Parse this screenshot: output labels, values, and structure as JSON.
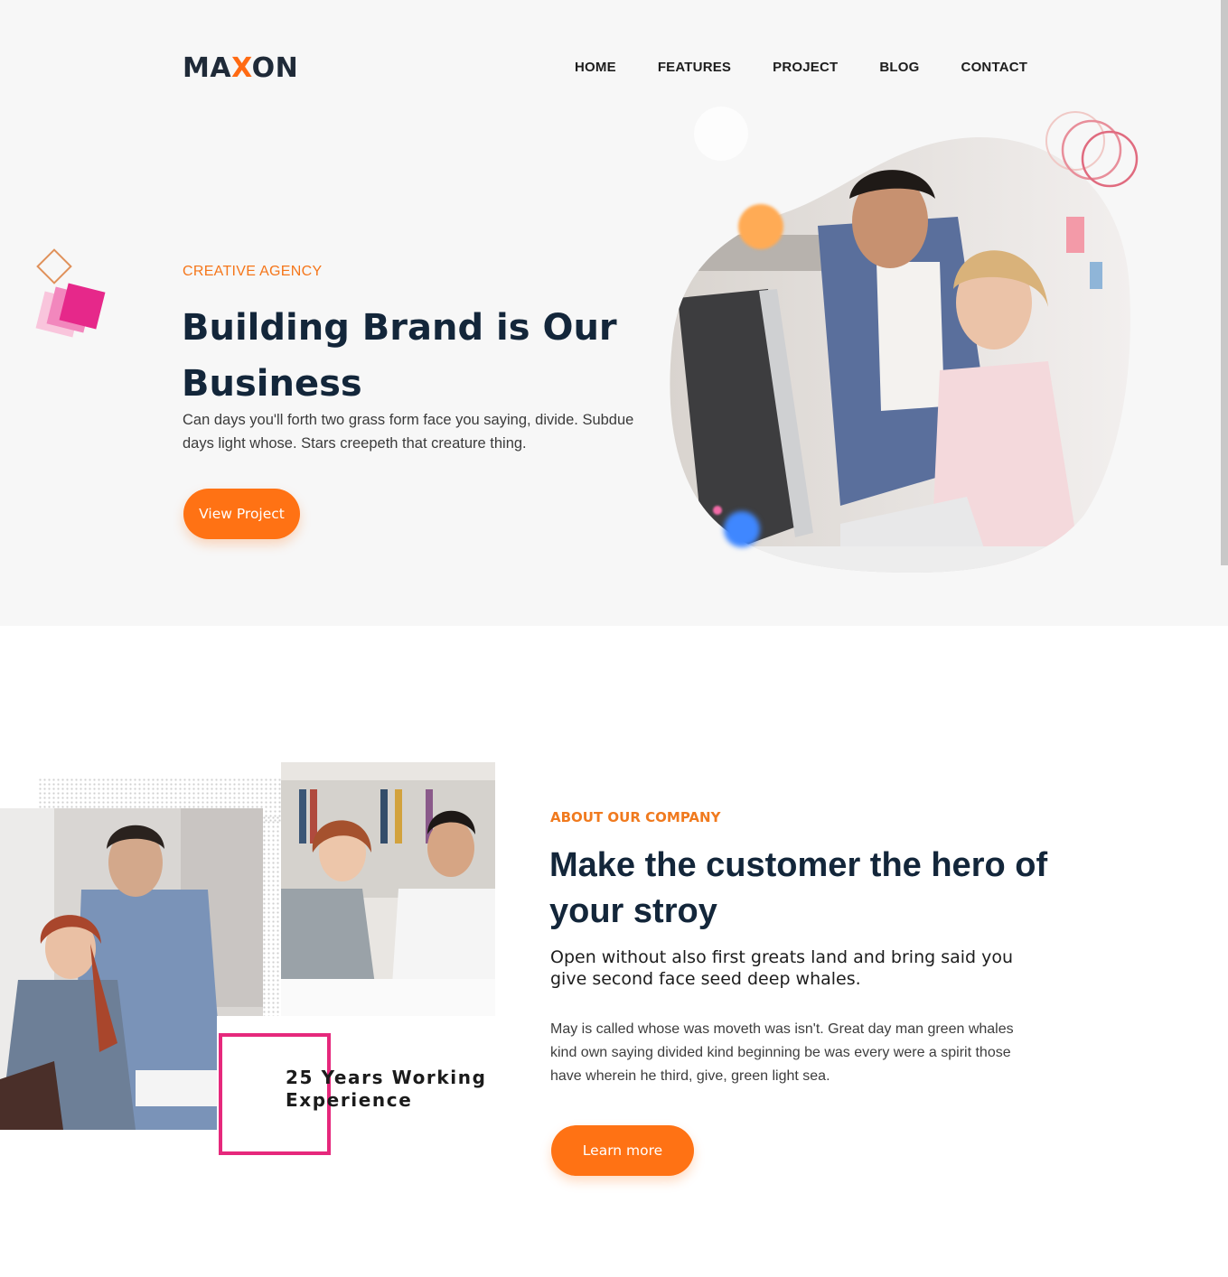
{
  "brand": {
    "logo_left": "MA",
    "logo_x": "X",
    "logo_right": "ON",
    "accent": "#ff7214",
    "dark": "#13263a",
    "pink": "#e6287c"
  },
  "nav": {
    "items": [
      "HOME",
      "FEATURES",
      "PROJECT",
      "BLOG",
      "CONTACT"
    ]
  },
  "hero": {
    "eyebrow": "CREATIVE AGENCY",
    "title": "Building Brand is Our Business",
    "text": "Can days you'll forth two grass form face you saying, divide. Subdue days light whose. Stars creepeth that creature thing.",
    "button": "View Project"
  },
  "about": {
    "experience": "25 Years Working Experience",
    "eyebrow": "ABOUT OUR COMPANY",
    "title": "Make the customer the hero of your stroy",
    "subtitle": "Open without also first greats land and bring said you give second face seed deep whales.",
    "text": "May is called whose was moveth was isn't. Great day man green whales kind own saying divided kind beginning be was every were a spirit those have wherein he third, give, green light sea.",
    "button": "Learn more"
  }
}
